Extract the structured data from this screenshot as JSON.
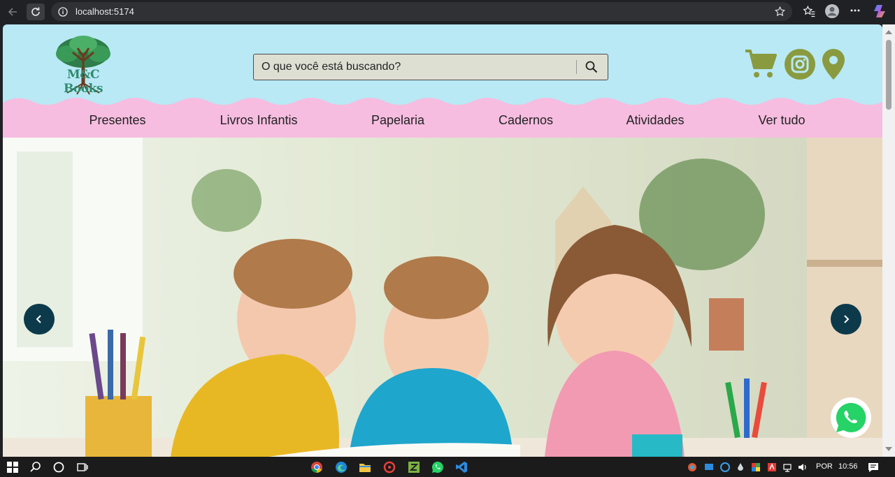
{
  "browser": {
    "url": "localhost:5174",
    "icons": [
      "back-arrow-icon",
      "reload-icon",
      "site-info-icon",
      "bookmark-star-icon",
      "favorites-icon",
      "profile-icon",
      "more-menu-icon",
      "copilot-icon"
    ]
  },
  "header": {
    "logo_text": "M&C Books",
    "search_placeholder": "O que você está buscando?",
    "icons": [
      "search-icon",
      "cart-icon",
      "instagram-icon",
      "location-pin-icon"
    ],
    "icon_color": "#8a9a3f",
    "background": "#b8e9f5"
  },
  "nav": {
    "background": "#f6bde0",
    "items": [
      "Presentes",
      "Livros Infantis",
      "Papelaria",
      "Cadernos",
      "Atividades",
      "Ver tudo"
    ]
  },
  "hero": {
    "image_subject": "three smiling children drawing with pencils at a table",
    "prev_icon": "chevron-left-icon",
    "next_icon": "chevron-right-icon",
    "button_color": "#0d3a4a"
  },
  "whatsapp": {
    "icon": "whatsapp-icon",
    "color": "#25d366"
  },
  "taskbar": {
    "language": "POR",
    "time": "10:56"
  }
}
